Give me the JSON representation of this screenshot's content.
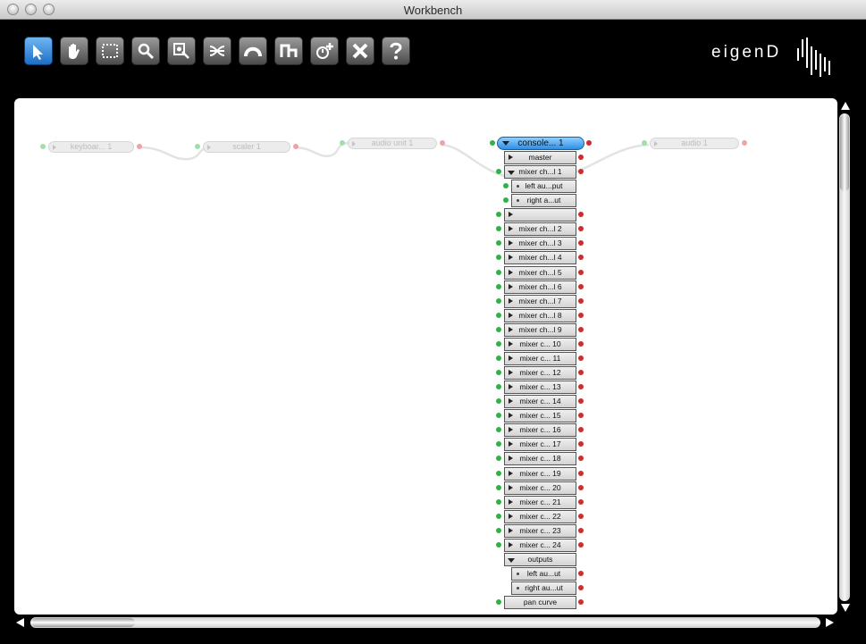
{
  "window": {
    "title": "Workbench"
  },
  "toolbar": {
    "tools": [
      {
        "name": "select",
        "icon": "arrow-pointer-icon",
        "active": true
      },
      {
        "name": "pan",
        "icon": "hand-icon"
      },
      {
        "name": "marquee",
        "icon": "dotted-rectangle-icon"
      },
      {
        "name": "zoom",
        "icon": "magnifier-icon"
      },
      {
        "name": "zoom-to-selection",
        "icon": "zoom-target-icon"
      },
      {
        "name": "connect",
        "icon": "wires-icon"
      },
      {
        "name": "route",
        "icon": "arc-icon"
      },
      {
        "name": "layout",
        "icon": "steps-icon"
      },
      {
        "name": "add-agent",
        "icon": "power-plus-icon"
      },
      {
        "name": "delete",
        "icon": "cross-icon"
      },
      {
        "name": "help",
        "icon": "question-mark-icon"
      }
    ],
    "brand": "eigenD",
    "brand_logo": "eigenlabs-logo"
  },
  "canvas": {
    "agents": [
      {
        "label": "keyboar... 1"
      },
      {
        "label": "scaler 1"
      },
      {
        "label": "audio unit 1"
      },
      {
        "label": "audio 1"
      }
    ],
    "console": {
      "header": "console... 1",
      "ports": [
        {
          "label": "master",
          "kind": "closed"
        },
        {
          "label": "mixer ch...l 1",
          "kind": "open"
        },
        {
          "label": "left au...put",
          "kind": "leaf"
        },
        {
          "label": "right a...ut",
          "kind": "leaf"
        },
        {
          "label": "",
          "kind": "closed"
        },
        {
          "label": "mixer ch...l 2",
          "kind": "closed"
        },
        {
          "label": "mixer ch...l 3",
          "kind": "closed"
        },
        {
          "label": "mixer ch...l 4",
          "kind": "closed"
        },
        {
          "label": "mixer ch...l 5",
          "kind": "closed"
        },
        {
          "label": "mixer ch...l 6",
          "kind": "closed"
        },
        {
          "label": "mixer ch...l 7",
          "kind": "closed"
        },
        {
          "label": "mixer ch...l 8",
          "kind": "closed"
        },
        {
          "label": "mixer ch...l 9",
          "kind": "closed"
        },
        {
          "label": "mixer c... 10",
          "kind": "closed"
        },
        {
          "label": "mixer c... 11",
          "kind": "closed"
        },
        {
          "label": "mixer c... 12",
          "kind": "closed"
        },
        {
          "label": "mixer c... 13",
          "kind": "closed"
        },
        {
          "label": "mixer c... 14",
          "kind": "closed"
        },
        {
          "label": "mixer c... 15",
          "kind": "closed"
        },
        {
          "label": "mixer c... 16",
          "kind": "closed"
        },
        {
          "label": "mixer c... 17",
          "kind": "closed"
        },
        {
          "label": "mixer c... 18",
          "kind": "closed"
        },
        {
          "label": "mixer c... 19",
          "kind": "closed"
        },
        {
          "label": "mixer c... 20",
          "kind": "closed"
        },
        {
          "label": "mixer c... 21",
          "kind": "closed"
        },
        {
          "label": "mixer c... 22",
          "kind": "closed"
        },
        {
          "label": "mixer c... 23",
          "kind": "closed"
        },
        {
          "label": "mixer c... 24",
          "kind": "closed"
        },
        {
          "label": "outputs",
          "kind": "open"
        },
        {
          "label": "left au...ut",
          "kind": "leaf"
        },
        {
          "label": "right au...ut",
          "kind": "leaf"
        },
        {
          "label": "pan curve",
          "kind": "plain"
        }
      ]
    }
  },
  "colors": {
    "console_header": "#3a9be8",
    "input_pin": "#2fb344",
    "output_pin": "#d12c2c"
  },
  "scroll": {
    "vertical_position": 0.0,
    "horizontal_position": 0.0
  }
}
